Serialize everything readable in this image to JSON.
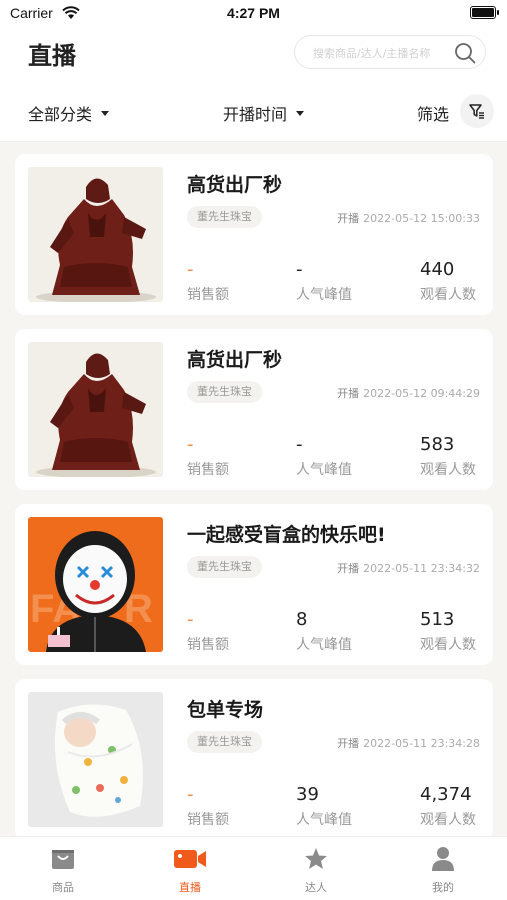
{
  "status_bar": {
    "carrier": "Carrier",
    "time": "4:27 PM"
  },
  "header": {
    "title": "直播",
    "search_placeholder": "搜索商品/达人/主播名称"
  },
  "filters": {
    "category": "全部分类",
    "start_time": "开播时间",
    "screen": "筛选"
  },
  "colors": {
    "accent": "#f05a1a",
    "dash": "#f08c4a"
  },
  "cards": [
    {
      "title": "高货出厂秒",
      "shop": "董先生珠宝",
      "start_label": "开播",
      "start_time": "2022-05-12 15:00:33",
      "sales": "-",
      "sales_label": "销售额",
      "peak": "-",
      "peak_label": "人气峰值",
      "viewers": "440",
      "viewers_label": "观看人数",
      "thumb": "statue"
    },
    {
      "title": "高货出厂秒",
      "shop": "董先生珠宝",
      "start_label": "开播",
      "start_time": "2022-05-12 09:44:29",
      "sales": "-",
      "sales_label": "销售额",
      "peak": "-",
      "peak_label": "人气峰值",
      "viewers": "583",
      "viewers_label": "观看人数",
      "thumb": "statue"
    },
    {
      "title": "一起感受盲盒的快乐吧!",
      "shop": "董先生珠宝",
      "start_label": "开播",
      "start_time": "2022-05-11 23:34:32",
      "sales": "-",
      "sales_label": "销售额",
      "peak": "8",
      "peak_label": "人气峰值",
      "viewers": "513",
      "viewers_label": "观看人数",
      "thumb": "clown"
    },
    {
      "title": "包单专场",
      "shop": "董先生珠宝",
      "start_label": "开播",
      "start_time": "2022-05-11 23:34:28",
      "sales": "-",
      "sales_label": "销售额",
      "peak": "39",
      "peak_label": "人气峰值",
      "viewers": "4,374",
      "viewers_label": "观看人数",
      "thumb": "baby"
    }
  ],
  "tabbar": [
    {
      "label": "商品",
      "icon": "bag-icon"
    },
    {
      "label": "直播",
      "icon": "video-icon",
      "active": true
    },
    {
      "label": "达人",
      "icon": "star-person-icon"
    },
    {
      "label": "我的",
      "icon": "person-icon"
    }
  ]
}
